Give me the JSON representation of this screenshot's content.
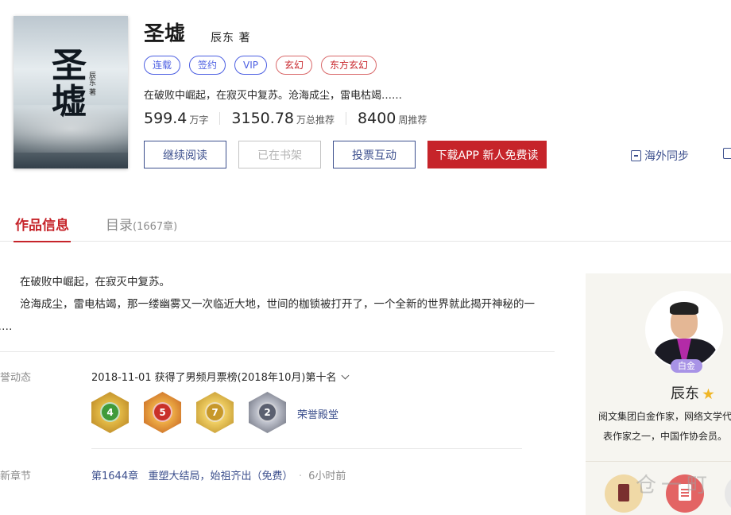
{
  "book": {
    "title": "圣墟",
    "author": "辰东 著",
    "cover_title": "圣墟",
    "cover_author": "辰东 著",
    "tags": [
      {
        "label": "连载",
        "style": "blue"
      },
      {
        "label": "签约",
        "style": "blue"
      },
      {
        "label": "VIP",
        "style": "blue"
      },
      {
        "label": "玄幻",
        "style": "red"
      },
      {
        "label": "东方玄幻",
        "style": "red"
      }
    ],
    "intro": "在破败中崛起，在寂灭中复苏。沧海成尘，雷电枯竭……",
    "stats": [
      {
        "value": "599.4",
        "unit": "万字"
      },
      {
        "value": "3150.78",
        "unit": "万总推荐"
      },
      {
        "value": "8400",
        "unit": "周推荐"
      }
    ]
  },
  "buttons": {
    "continue_read": "继续阅读",
    "on_shelf": "已在书架",
    "vote": "投票互动",
    "download": "下载APP  新人免费读"
  },
  "overseas": "海外同步",
  "tabs": {
    "info": "作品信息",
    "catalog": "目录",
    "catalog_count": "(1667章)"
  },
  "description": {
    "line1": "在破败中崛起，在寂灭中复苏。",
    "line2": "沧海成尘，雷电枯竭，那一缕幽雾又一次临近大地，世间的枷锁被打开了，一个全新的世界就此揭开神秘的一角……"
  },
  "honor": {
    "label": "荣誉动态",
    "text": "2018-11-01  获得了男频月票榜(2018年10月)第十名",
    "medals": [
      {
        "num": "4",
        "name": "green-medal-icon"
      },
      {
        "num": "5",
        "name": "red-medal-icon"
      },
      {
        "num": "7",
        "name": "gold-medal-icon"
      },
      {
        "num": "2",
        "name": "gray-medal-icon"
      }
    ],
    "hall": "荣誉殿堂"
  },
  "latest": {
    "label": "最新章节",
    "chapter": "第1644章",
    "title": "重塑大结局，始祖齐出（免费）",
    "time": "6小时前"
  },
  "author_panel": {
    "badge": "白金",
    "name": "辰东",
    "desc": "阅文集团白金作家，网络文学代表作家之一，中国作协会员。"
  },
  "watermark": "仓一町"
}
